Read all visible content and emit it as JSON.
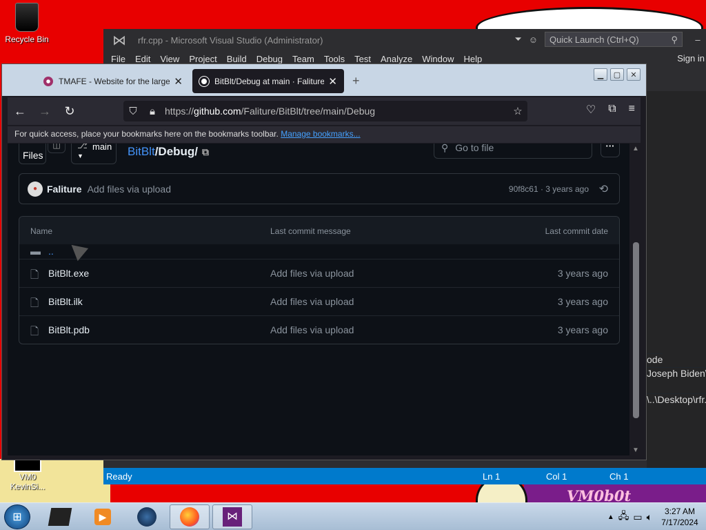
{
  "desktop": {
    "recycle_bin": "Recycle Bin",
    "vm_icon": "VM0\nKevinSi...",
    "wallpaper_text": "VM0b0t"
  },
  "vs": {
    "title": "rfr.cpp - Microsoft Visual Studio (Administrator)",
    "quick_launch": "Quick Launch (Ctrl+Q)",
    "menu": [
      "File",
      "Edit",
      "View",
      "Project",
      "Build",
      "Debug",
      "Team",
      "Tools",
      "Test",
      "Analyze",
      "Window",
      "Help"
    ],
    "sign_in": "Sign in",
    "side_text_1": "ode",
    "side_text_2": "Joseph Biden\\De",
    "side_text_3": "\\..\\Desktop\\rfr.c",
    "status_ready": "Ready",
    "status_ln": "Ln 1",
    "status_col": "Col 1",
    "status_ch": "Ch 1"
  },
  "firefox": {
    "tabs": [
      {
        "title": "TMAFE - Website for the largest",
        "active": false
      },
      {
        "title": "BitBlt/Debug at main · Faliture/BitBlt",
        "active": true
      }
    ],
    "url_prefix": "https://",
    "url_host": "github.com",
    "url_path": "/Faliture/BitBlt/tree/main/Debug",
    "bookmarks_text": "For quick access, place your bookmarks here on the bookmarks toolbar.",
    "bookmarks_link": "Manage bookmarks..."
  },
  "github": {
    "files_label": "Files",
    "branch": "main",
    "repo": "BitBlt",
    "path_rest": "/Debug/",
    "go_to_file": "Go to file",
    "commit": {
      "author": "Faliture",
      "message": "Add files via upload",
      "meta": "90f8c61 · 3 years ago"
    },
    "table": {
      "headers": {
        "name": "Name",
        "message": "Last commit message",
        "date": "Last commit date"
      },
      "parent": "..",
      "rows": [
        {
          "name": "BitBlt.exe",
          "message": "Add files via upload",
          "date": "3 years ago"
        },
        {
          "name": "BitBlt.ilk",
          "message": "Add files via upload",
          "date": "3 years ago"
        },
        {
          "name": "BitBlt.pdb",
          "message": "Add files via upload",
          "date": "3 years ago"
        }
      ]
    }
  },
  "taskbar": {
    "time": "3:27 AM",
    "date": "7/17/2024"
  },
  "colors": {
    "desktop_red": "#e80000",
    "github_bg": "#0d1117",
    "link_blue": "#4493f8",
    "vs_status": "#007acc"
  }
}
